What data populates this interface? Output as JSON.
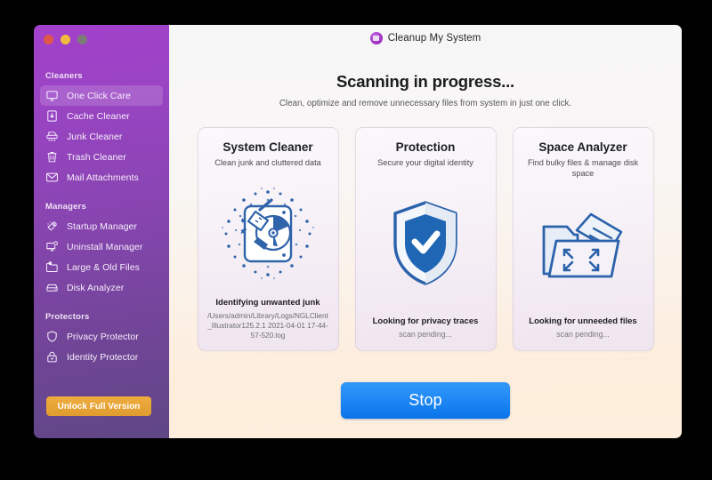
{
  "window": {
    "traffic_lights": [
      "close",
      "minimize",
      "zoom"
    ],
    "app_title": "Cleanup My System"
  },
  "sidebar": {
    "sections": [
      {
        "label": "Cleaners",
        "items": [
          {
            "label": "One Click Care",
            "icon": "monitor-icon",
            "active": true
          },
          {
            "label": "Cache Cleaner",
            "icon": "cache-box-icon",
            "active": false
          },
          {
            "label": "Junk Cleaner",
            "icon": "shredder-icon",
            "active": false
          },
          {
            "label": "Trash Cleaner",
            "icon": "trash-bin-icon",
            "active": false
          },
          {
            "label": "Mail Attachments",
            "icon": "envelope-icon",
            "active": false
          }
        ]
      },
      {
        "label": "Managers",
        "items": [
          {
            "label": "Startup Manager",
            "icon": "rocket-icon",
            "active": false
          },
          {
            "label": "Uninstall Manager",
            "icon": "monitor-minus-icon",
            "active": false
          },
          {
            "label": "Large & Old Files",
            "icon": "folder-clock-icon",
            "active": false
          },
          {
            "label": "Disk Analyzer",
            "icon": "disk-icon",
            "active": false
          }
        ]
      },
      {
        "label": "Protectors",
        "items": [
          {
            "label": "Privacy Protector",
            "icon": "shield-icon",
            "active": false
          },
          {
            "label": "Identity Protector",
            "icon": "lock-icon",
            "active": false
          }
        ]
      }
    ],
    "unlock_button": "Unlock Full Version"
  },
  "main": {
    "headline": "Scanning in progress...",
    "subhead": "Clean, optimize and remove unnecessary files from system in just one click.",
    "stop_button": "Stop",
    "cards": [
      {
        "title": "System Cleaner",
        "subtitle": "Clean junk and cluttered data",
        "icon": "disk-broom-icon",
        "status": "Identifying unwanted junk",
        "detail": "/Users/admin/Library/Logs/NGLClient_Illustrator125.2.1 2021-04-01 17-44-57-520.log",
        "pending": false
      },
      {
        "title": "Protection",
        "subtitle": "Secure your digital identity",
        "icon": "shield-check-icon",
        "status": "Looking for privacy traces",
        "detail": "scan pending...",
        "pending": true
      },
      {
        "title": "Space Analyzer",
        "subtitle": "Find bulky files & manage disk space",
        "icon": "folder-expand-icon",
        "status": "Looking for unneeded files",
        "detail": "scan pending...",
        "pending": true
      }
    ]
  },
  "colors": {
    "sidebar_top": "#a340cb",
    "sidebar_bottom": "#5f4685",
    "accent_blue": "#1f8bf5",
    "accent_orange": "#efac3e",
    "icon_blue": "#1f5fa8",
    "main_bottom": "#fdeedd"
  }
}
